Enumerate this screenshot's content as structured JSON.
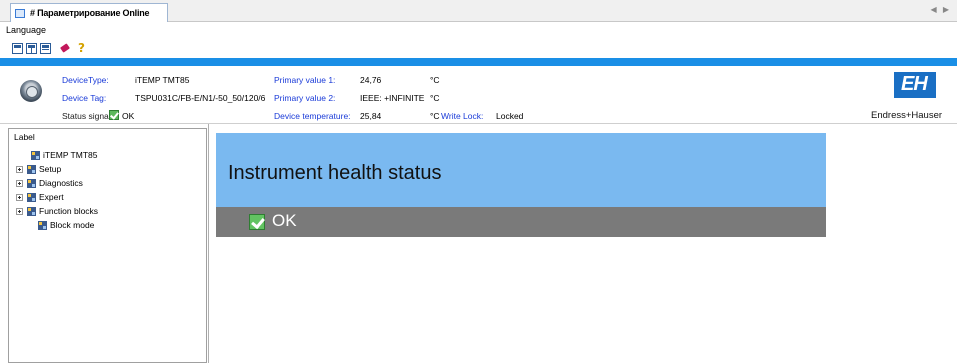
{
  "window": {
    "tab_title": "# Параметрирование Online",
    "tab_scroll": "◀ ▶"
  },
  "menu": {
    "language": "Language"
  },
  "toolbar": {
    "help_glyph": "?"
  },
  "device": {
    "device_type_label": "DeviceType:",
    "device_type_value": "iTEMP TMT85",
    "device_tag_label": "Device Tag:",
    "device_tag_value": "TSPU031C/FB-E/N1/-50_50/120/6",
    "status_signal_label": "Status signal",
    "status_signal_value": "OK",
    "primary_value1_label": "Primary value 1:",
    "primary_value1_value": "24,76",
    "primary_value1_unit": "°C",
    "primary_value2_label": "Primary value 2:",
    "primary_value2_value": "IEEE: +INFINITE",
    "primary_value2_unit": "°C",
    "device_temp_label": "Device temperature:",
    "device_temp_value": "25,84",
    "device_temp_unit": "°C",
    "write_lock_label": "Write Lock:",
    "write_lock_value": "Locked"
  },
  "brand": {
    "logo_text": "EH",
    "name": "Endress+Hauser",
    "color": "#1a6fc4"
  },
  "tree": {
    "header": "Label",
    "items": [
      {
        "label": "iTEMP TMT85",
        "expandable": false
      },
      {
        "label": "Setup",
        "expandable": true
      },
      {
        "label": "Diagnostics",
        "expandable": true
      },
      {
        "label": "Expert",
        "expandable": true
      },
      {
        "label": "Function blocks",
        "expandable": true
      },
      {
        "label": "Block mode",
        "expandable": false
      }
    ]
  },
  "health": {
    "title": "Instrument health status",
    "status": "OK",
    "title_bg": "#7ab9f0",
    "status_bg": "#7a7a7a"
  }
}
